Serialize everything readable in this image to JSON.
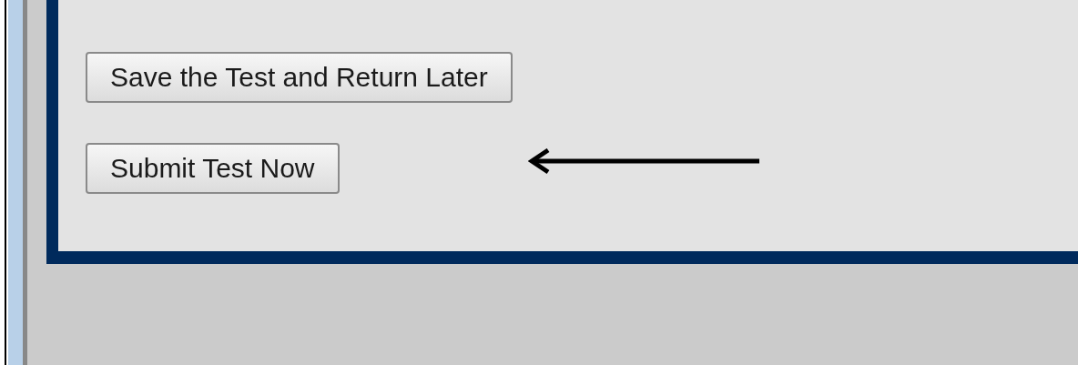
{
  "buttons": [
    {
      "label": "Save the Test and Return Later"
    },
    {
      "label": "Submit Test Now"
    }
  ]
}
